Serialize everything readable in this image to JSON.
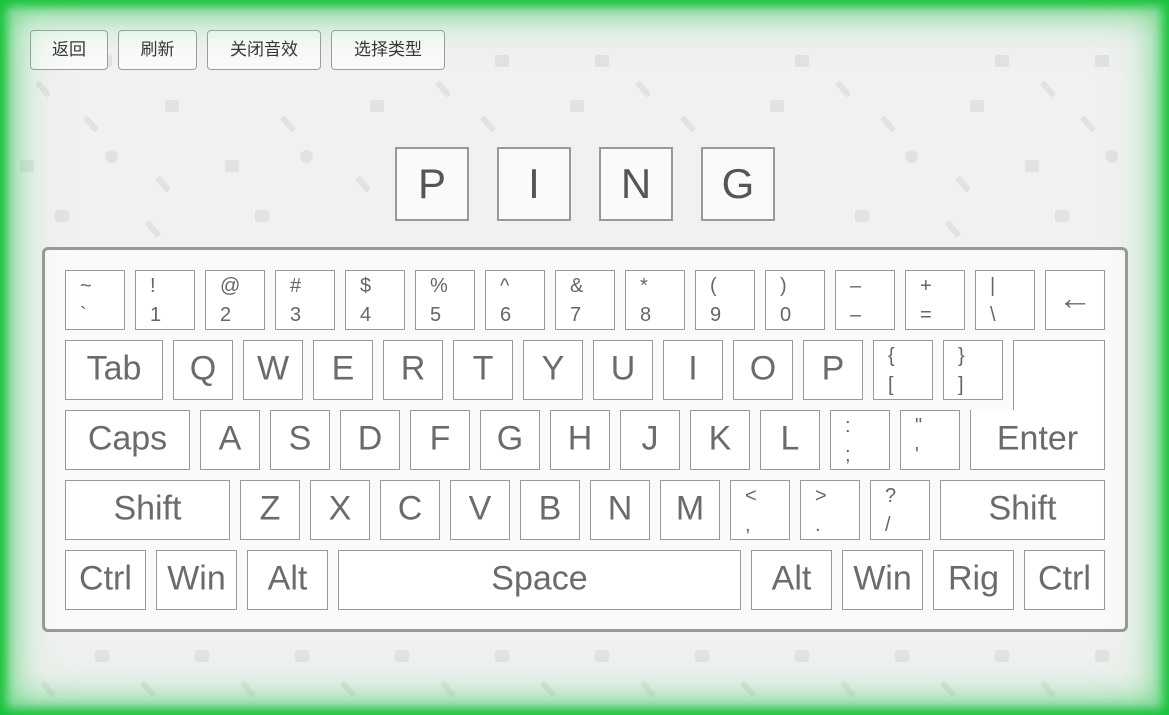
{
  "toolbar": {
    "back_label": "返回",
    "refresh_label": "刷新",
    "sound_label": "关闭音效",
    "type_label": "选择类型"
  },
  "word": {
    "letters": [
      "P",
      "I",
      "N",
      "G"
    ]
  },
  "keyboard": {
    "row1": [
      {
        "up": "~",
        "dn": "`"
      },
      {
        "up": "!",
        "dn": "1"
      },
      {
        "up": "@",
        "dn": "2"
      },
      {
        "up": "#",
        "dn": "3"
      },
      {
        "up": "$",
        "dn": "4"
      },
      {
        "up": "%",
        "dn": "5"
      },
      {
        "up": "^",
        "dn": "6"
      },
      {
        "up": "&",
        "dn": "7"
      },
      {
        "up": "*",
        "dn": "8"
      },
      {
        "up": "(",
        "dn": "9"
      },
      {
        "up": ")",
        "dn": "0"
      },
      {
        "up": "–",
        "dn": "–"
      },
      {
        "up": "+",
        "dn": "="
      },
      {
        "up": "|",
        "dn": "\\"
      }
    ],
    "backspace": "←",
    "tab": "Tab",
    "row2": [
      "Q",
      "W",
      "E",
      "R",
      "T",
      "Y",
      "U",
      "I",
      "O",
      "P"
    ],
    "row2_sym": [
      {
        "up": "{",
        "dn": "["
      },
      {
        "up": "}",
        "dn": "]"
      }
    ],
    "caps": "Caps",
    "row3": [
      "A",
      "S",
      "D",
      "F",
      "G",
      "H",
      "J",
      "K",
      "L"
    ],
    "row3_sym": [
      {
        "up": ":",
        "dn": ";"
      },
      {
        "up": "\"",
        "dn": "'"
      }
    ],
    "enter": "Enter",
    "shift": "Shift",
    "row4": [
      "Z",
      "X",
      "C",
      "V",
      "B",
      "N",
      "M"
    ],
    "row4_sym": [
      {
        "up": "<",
        "dn": ","
      },
      {
        "up": ">",
        "dn": "."
      },
      {
        "up": "?",
        "dn": "/"
      }
    ],
    "ctrl": "Ctrl",
    "win": "Win",
    "alt": "Alt",
    "space": "Space",
    "rig": "Rig"
  }
}
